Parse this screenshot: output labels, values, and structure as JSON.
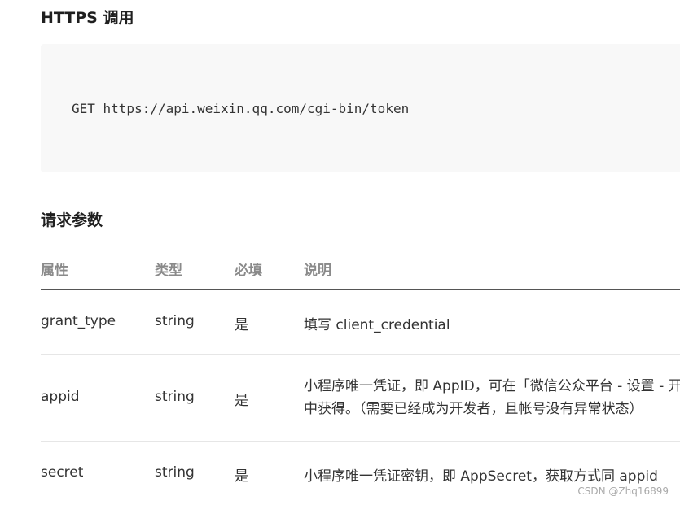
{
  "sections": {
    "https_title": "HTTPS 调用",
    "code": "GET https://api.weixin.qq.com/cgi-bin/token",
    "params_title": "请求参数"
  },
  "table": {
    "headers": [
      "属性",
      "类型",
      "必填",
      "说明"
    ],
    "rows": [
      {
        "name": "grant_type",
        "type": "string",
        "required": "是",
        "desc": [
          "填写 client_credential"
        ]
      },
      {
        "name": "appid",
        "type": "string",
        "required": "是",
        "desc": [
          "小程序唯一凭证，即 AppID，可在「微信公众平台 - 设置 - 开发设置」页",
          "中获得。（需要已经成为开发者，且帐号没有异常状态）"
        ]
      },
      {
        "name": "secret",
        "type": "string",
        "required": "是",
        "desc": [
          "小程序唯一凭证密钥，即 AppSecret，获取方式同 appid"
        ]
      }
    ]
  },
  "watermark": "CSDN @Zhq16899"
}
